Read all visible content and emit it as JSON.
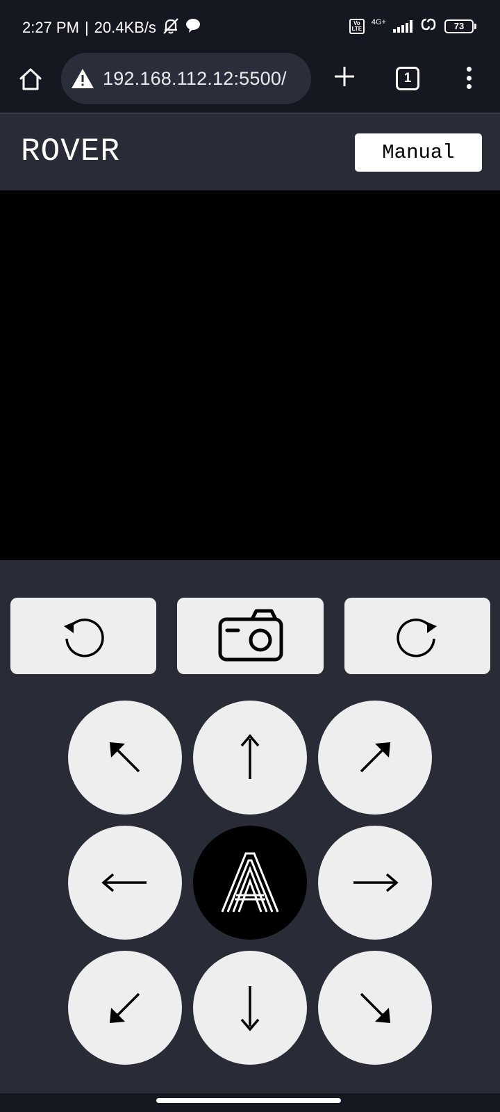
{
  "status": {
    "time": "2:27 PM",
    "separator": "|",
    "speed": "20.4KB/s",
    "volte": "Vo LTE",
    "network": "4G+",
    "battery": "73"
  },
  "browser": {
    "url": "192.168.112.12:5500/",
    "tab_count": "1"
  },
  "app": {
    "title": "ROVER",
    "mode_label": "Manual"
  },
  "icons": {
    "home": "home-icon",
    "warning": "warning-icon",
    "plus": "plus-icon",
    "more": "more-vert-icon",
    "rotate_left": "rotate-ccw-icon",
    "camera": "camera-icon",
    "rotate_right": "rotate-cw-icon",
    "logo": "rover-a-logo-icon"
  },
  "colors": {
    "status_bg": "#151821",
    "page_bg": "#292b37",
    "button_bg": "#eeeeee",
    "video_bg": "#000000"
  }
}
